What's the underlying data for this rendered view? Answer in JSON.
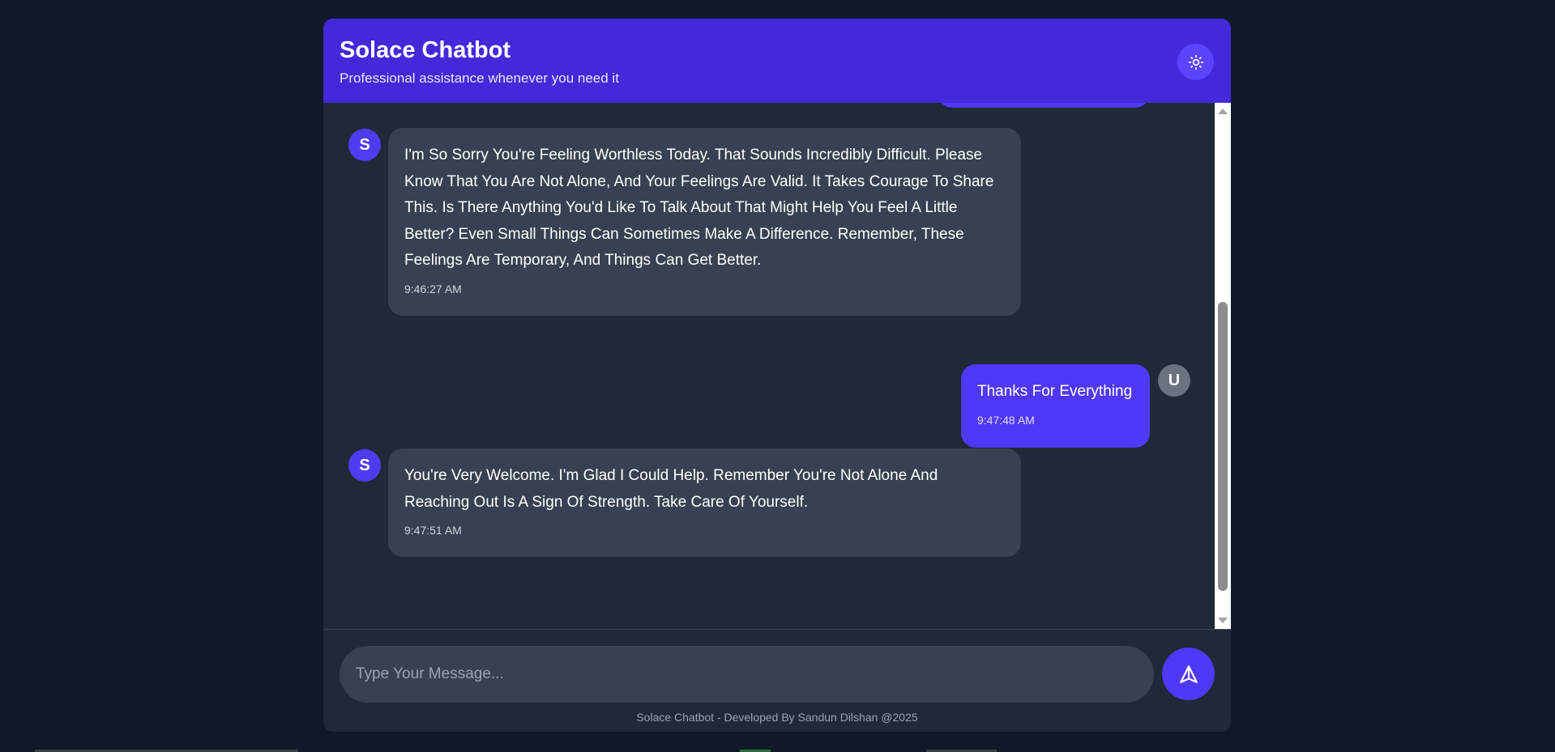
{
  "header": {
    "title": "Solace Chatbot",
    "subtitle": "Professional assistance whenever you need it",
    "theme_toggle_icon": "sun-icon"
  },
  "messages": [
    {
      "sender": "bot",
      "avatar": "S",
      "text": "I'm So Sorry You're Feeling Worthless Today. That Sounds Incredibly Difficult. Please Know That You Are Not Alone, And Your Feelings Are Valid. It Takes Courage To Share This. Is There Anything You'd Like To Talk About That Might Help You Feel A Little Better? Even Small Things Can Sometimes Make A Difference. Remember, These Feelings Are Temporary, And Things Can Get Better.",
      "time": "9:46:27 AM"
    },
    {
      "sender": "user",
      "avatar": "U",
      "text": "Thanks For Everything",
      "time": "9:47:48 AM"
    },
    {
      "sender": "bot",
      "avatar": "S",
      "text": "You're Very Welcome. I'm Glad I Could Help. Remember You're Not Alone And Reaching Out Is A Sign Of Strength. Take Care Of Yourself.",
      "time": "9:47:51 AM"
    }
  ],
  "input": {
    "placeholder": "Type Your Message...",
    "value": "",
    "send_icon": "send-icon"
  },
  "footer": {
    "text": "Solace Chatbot - Developed By Sandun Dilshan @2025"
  },
  "colors": {
    "page_background": "#111827",
    "panel_background": "#1f2937",
    "header_accent": "#4229da",
    "user_bubble": "#4f39f6",
    "bot_bubble": "#374151",
    "user_avatar": "#6b7280"
  }
}
